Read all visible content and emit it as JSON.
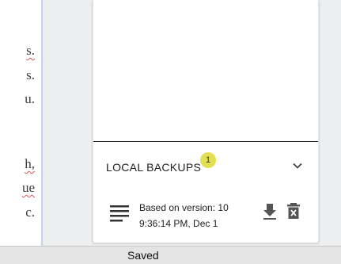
{
  "document": {
    "lines": [
      {
        "text": "s.",
        "underline": true
      },
      {
        "text": "s.",
        "underline": false
      },
      {
        "text": "u.",
        "underline": false
      },
      {
        "text": "h,",
        "underline": true
      },
      {
        "text": "ue",
        "underline": true
      },
      {
        "text": "c.",
        "underline": false
      }
    ]
  },
  "backups": {
    "title": "LOCAL BACKUPS",
    "badge_count": "1",
    "items": [
      {
        "version": "Based on version: 10",
        "timestamp": "9:36:14 PM, Dec 1"
      }
    ]
  },
  "statusbar": {
    "text": "Saved"
  },
  "colors": {
    "badge": "#e3df52",
    "doc_edge": "#c4d4ef",
    "squiggle": "#e05555"
  },
  "icons": [
    "document-lines-icon",
    "chevron-down-icon",
    "download-icon",
    "delete-icon"
  ]
}
